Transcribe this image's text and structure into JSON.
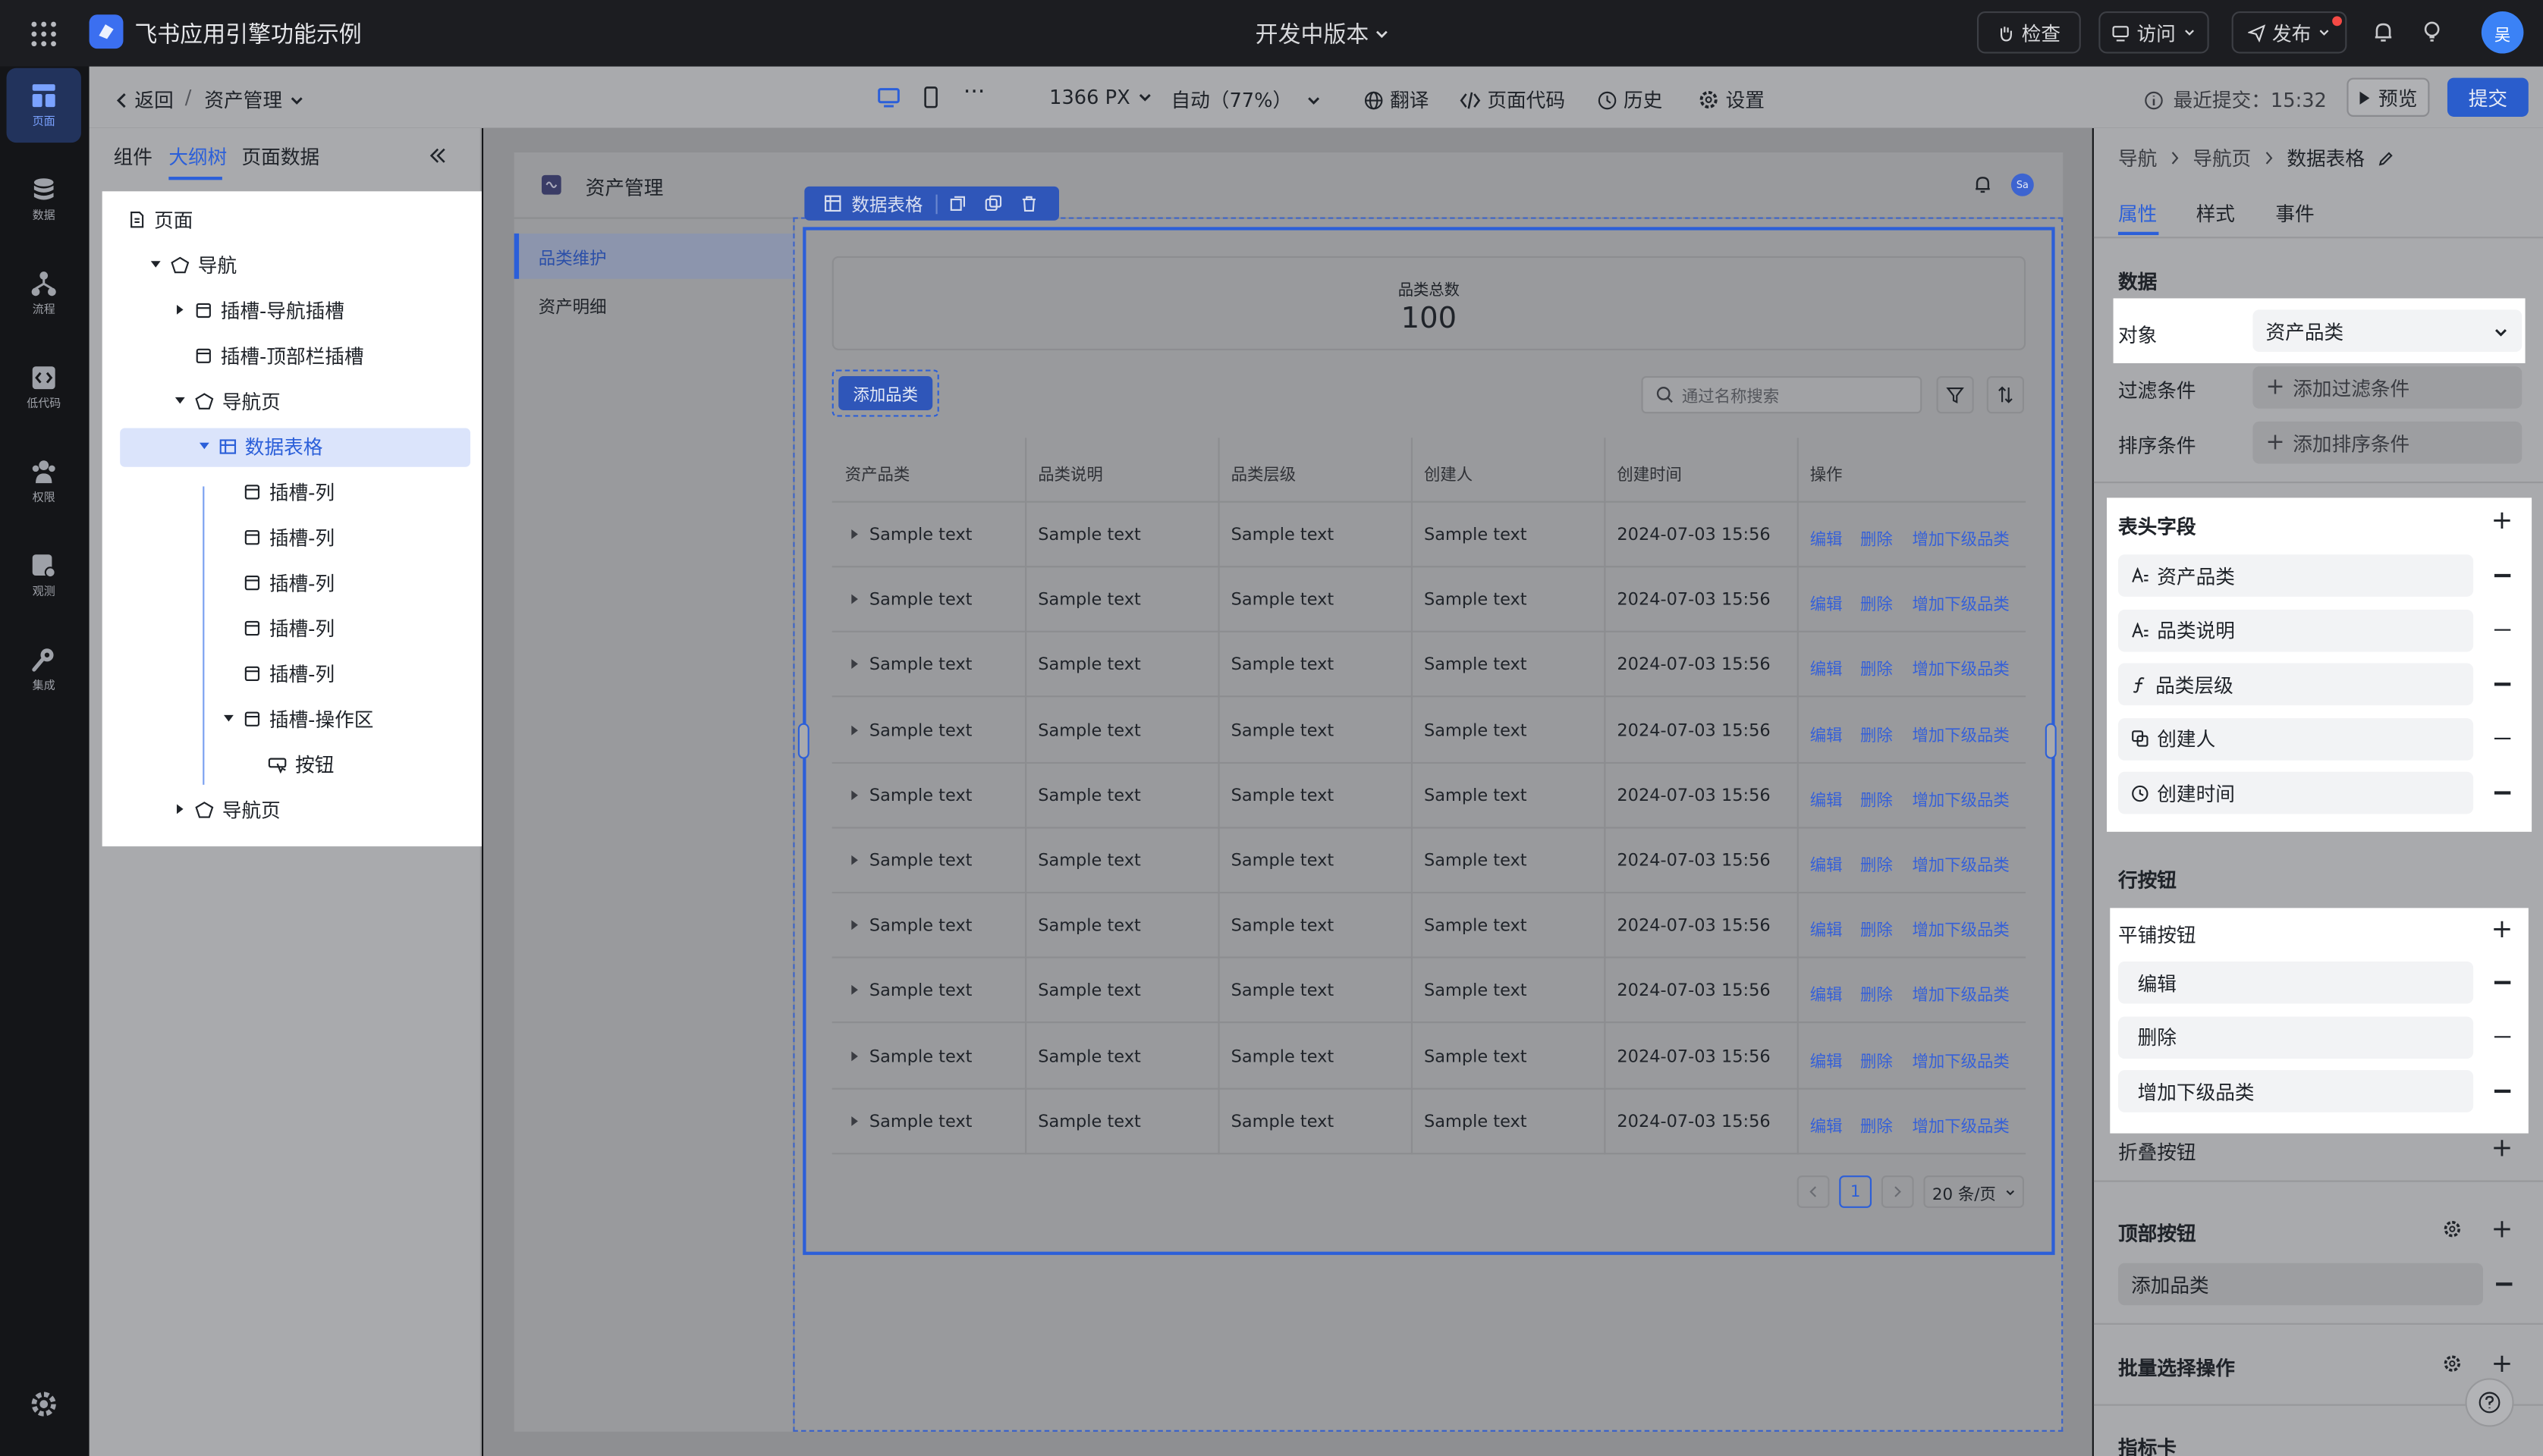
{
  "topbar": {
    "app_title": "飞书应用引擎功能示例",
    "version": "开发中版本",
    "check": "检查",
    "visit": "访问",
    "publish": "发布",
    "avatar": "吴"
  },
  "rail": [
    {
      "label": "页面",
      "icon": "page-icon"
    },
    {
      "label": "数据",
      "icon": "database-icon"
    },
    {
      "label": "流程",
      "icon": "flow-icon"
    },
    {
      "label": "低代码",
      "icon": "code-icon"
    },
    {
      "label": "权限",
      "icon": "users-icon"
    },
    {
      "label": "观测",
      "icon": "monitor-icon"
    },
    {
      "label": "集成",
      "icon": "wrench-icon"
    }
  ],
  "editor": {
    "back": "返回",
    "page_name": "资产管理",
    "width": "1366 PX",
    "zoom": "自动（77%）",
    "translate": "翻译",
    "page_code": "页面代码",
    "history": "历史",
    "settings": "设置",
    "last_commit": "最近提交：15:32",
    "preview": "预览",
    "submit": "提交"
  },
  "left_panel": {
    "tabs": [
      "组件",
      "大纲树",
      "页面数据"
    ],
    "active_tab": "大纲树",
    "tree": [
      {
        "label": "页面",
        "level": 0,
        "icon": "page",
        "arrow": ""
      },
      {
        "label": "导航",
        "level": 1,
        "icon": "nav",
        "arrow": "down"
      },
      {
        "label": "插槽-导航插槽",
        "level": 2,
        "icon": "slot",
        "arrow": "right"
      },
      {
        "label": "插槽-顶部栏插槽",
        "level": 2,
        "icon": "slot",
        "arrow": ""
      },
      {
        "label": "导航页",
        "level": 2,
        "icon": "nav",
        "arrow": "down"
      },
      {
        "label": "数据表格",
        "level": 3,
        "icon": "table",
        "arrow": "down",
        "selected": true
      },
      {
        "label": "插槽-列",
        "level": 4,
        "icon": "slot",
        "arrow": ""
      },
      {
        "label": "插槽-列",
        "level": 4,
        "icon": "slot",
        "arrow": ""
      },
      {
        "label": "插槽-列",
        "level": 4,
        "icon": "slot",
        "arrow": ""
      },
      {
        "label": "插槽-列",
        "level": 4,
        "icon": "slot",
        "arrow": ""
      },
      {
        "label": "插槽-列",
        "level": 4,
        "icon": "slot",
        "arrow": ""
      },
      {
        "label": "插槽-操作区",
        "level": 4,
        "icon": "slot",
        "arrow": "down"
      },
      {
        "label": "按钮",
        "level": 5,
        "icon": "button",
        "arrow": ""
      },
      {
        "label": "导航页",
        "level": 2,
        "icon": "nav",
        "arrow": "right"
      }
    ]
  },
  "app": {
    "title": "资产管理",
    "avatar": "Sa",
    "menu": [
      "品类维护",
      "资产明细"
    ],
    "active_menu": "品类维护",
    "table_toolbar_label": "数据表格",
    "stat_label": "品类总数",
    "stat_value": "100",
    "add_button": "添加品类",
    "search_placeholder": "通过名称搜索",
    "columns": [
      "资产品类",
      "品类说明",
      "品类层级",
      "创建人",
      "创建时间",
      "操作"
    ],
    "row_cell": "Sample text",
    "row_time": "2024-07-03 15:56",
    "row_actions": [
      "编辑",
      "删除",
      "增加下级品类"
    ],
    "row_count": 10,
    "page": "1",
    "page_size": "20 条/页"
  },
  "right_panel": {
    "breadcrumb": [
      "导航",
      "导航页",
      "数据表格"
    ],
    "tabs": [
      "属性",
      "样式",
      "事件"
    ],
    "active_tab": "属性",
    "data_title": "数据",
    "object_label": "对象",
    "object_value": "资产品类",
    "filter_label": "过滤条件",
    "filter_add": "添加过滤条件",
    "sort_label": "排序条件",
    "sort_add": "添加排序条件",
    "header_fields_title": "表头字段",
    "header_fields": [
      {
        "label": "资产品类",
        "icon": "text-icon"
      },
      {
        "label": "品类说明",
        "icon": "text-icon"
      },
      {
        "label": "品类层级",
        "icon": "formula-icon"
      },
      {
        "label": "创建人",
        "icon": "lookup-icon"
      },
      {
        "label": "创建时间",
        "icon": "clock-icon"
      }
    ],
    "row_buttons_title": "行按钮",
    "tile_buttons_title": "平铺按钮",
    "tile_buttons": [
      "编辑",
      "删除",
      "增加下级品类"
    ],
    "fold_buttons_title": "折叠按钮",
    "top_buttons_title": "顶部按钮",
    "top_buttons": [
      "添加品类"
    ],
    "batch_title": "批量选择操作",
    "indicator_title": "指标卡"
  }
}
